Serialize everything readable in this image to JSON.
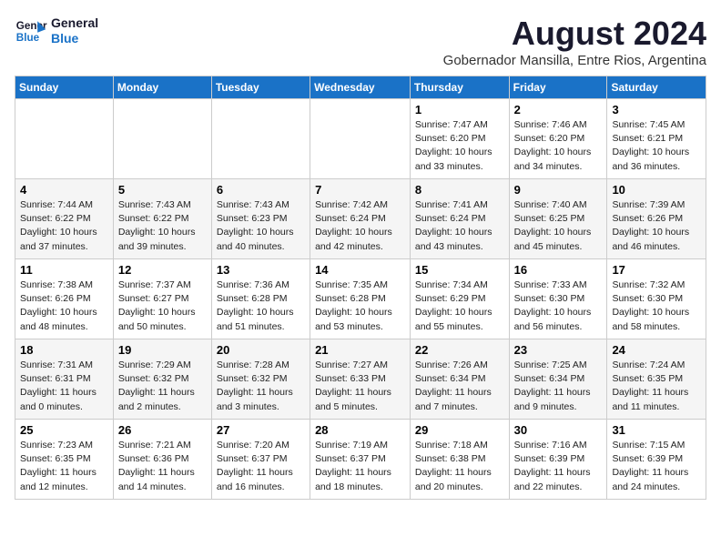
{
  "logo": {
    "line1": "General",
    "line2": "Blue"
  },
  "title": "August 2024",
  "subtitle": "Gobernador Mansilla, Entre Rios, Argentina",
  "days_of_week": [
    "Sunday",
    "Monday",
    "Tuesday",
    "Wednesday",
    "Thursday",
    "Friday",
    "Saturday"
  ],
  "weeks": [
    [
      {
        "day": "",
        "info": ""
      },
      {
        "day": "",
        "info": ""
      },
      {
        "day": "",
        "info": ""
      },
      {
        "day": "",
        "info": ""
      },
      {
        "day": "1",
        "info": "Sunrise: 7:47 AM\nSunset: 6:20 PM\nDaylight: 10 hours\nand 33 minutes."
      },
      {
        "day": "2",
        "info": "Sunrise: 7:46 AM\nSunset: 6:20 PM\nDaylight: 10 hours\nand 34 minutes."
      },
      {
        "day": "3",
        "info": "Sunrise: 7:45 AM\nSunset: 6:21 PM\nDaylight: 10 hours\nand 36 minutes."
      }
    ],
    [
      {
        "day": "4",
        "info": "Sunrise: 7:44 AM\nSunset: 6:22 PM\nDaylight: 10 hours\nand 37 minutes."
      },
      {
        "day": "5",
        "info": "Sunrise: 7:43 AM\nSunset: 6:22 PM\nDaylight: 10 hours\nand 39 minutes."
      },
      {
        "day": "6",
        "info": "Sunrise: 7:43 AM\nSunset: 6:23 PM\nDaylight: 10 hours\nand 40 minutes."
      },
      {
        "day": "7",
        "info": "Sunrise: 7:42 AM\nSunset: 6:24 PM\nDaylight: 10 hours\nand 42 minutes."
      },
      {
        "day": "8",
        "info": "Sunrise: 7:41 AM\nSunset: 6:24 PM\nDaylight: 10 hours\nand 43 minutes."
      },
      {
        "day": "9",
        "info": "Sunrise: 7:40 AM\nSunset: 6:25 PM\nDaylight: 10 hours\nand 45 minutes."
      },
      {
        "day": "10",
        "info": "Sunrise: 7:39 AM\nSunset: 6:26 PM\nDaylight: 10 hours\nand 46 minutes."
      }
    ],
    [
      {
        "day": "11",
        "info": "Sunrise: 7:38 AM\nSunset: 6:26 PM\nDaylight: 10 hours\nand 48 minutes."
      },
      {
        "day": "12",
        "info": "Sunrise: 7:37 AM\nSunset: 6:27 PM\nDaylight: 10 hours\nand 50 minutes."
      },
      {
        "day": "13",
        "info": "Sunrise: 7:36 AM\nSunset: 6:28 PM\nDaylight: 10 hours\nand 51 minutes."
      },
      {
        "day": "14",
        "info": "Sunrise: 7:35 AM\nSunset: 6:28 PM\nDaylight: 10 hours\nand 53 minutes."
      },
      {
        "day": "15",
        "info": "Sunrise: 7:34 AM\nSunset: 6:29 PM\nDaylight: 10 hours\nand 55 minutes."
      },
      {
        "day": "16",
        "info": "Sunrise: 7:33 AM\nSunset: 6:30 PM\nDaylight: 10 hours\nand 56 minutes."
      },
      {
        "day": "17",
        "info": "Sunrise: 7:32 AM\nSunset: 6:30 PM\nDaylight: 10 hours\nand 58 minutes."
      }
    ],
    [
      {
        "day": "18",
        "info": "Sunrise: 7:31 AM\nSunset: 6:31 PM\nDaylight: 11 hours\nand 0 minutes."
      },
      {
        "day": "19",
        "info": "Sunrise: 7:29 AM\nSunset: 6:32 PM\nDaylight: 11 hours\nand 2 minutes."
      },
      {
        "day": "20",
        "info": "Sunrise: 7:28 AM\nSunset: 6:32 PM\nDaylight: 11 hours\nand 3 minutes."
      },
      {
        "day": "21",
        "info": "Sunrise: 7:27 AM\nSunset: 6:33 PM\nDaylight: 11 hours\nand 5 minutes."
      },
      {
        "day": "22",
        "info": "Sunrise: 7:26 AM\nSunset: 6:34 PM\nDaylight: 11 hours\nand 7 minutes."
      },
      {
        "day": "23",
        "info": "Sunrise: 7:25 AM\nSunset: 6:34 PM\nDaylight: 11 hours\nand 9 minutes."
      },
      {
        "day": "24",
        "info": "Sunrise: 7:24 AM\nSunset: 6:35 PM\nDaylight: 11 hours\nand 11 minutes."
      }
    ],
    [
      {
        "day": "25",
        "info": "Sunrise: 7:23 AM\nSunset: 6:35 PM\nDaylight: 11 hours\nand 12 minutes."
      },
      {
        "day": "26",
        "info": "Sunrise: 7:21 AM\nSunset: 6:36 PM\nDaylight: 11 hours\nand 14 minutes."
      },
      {
        "day": "27",
        "info": "Sunrise: 7:20 AM\nSunset: 6:37 PM\nDaylight: 11 hours\nand 16 minutes."
      },
      {
        "day": "28",
        "info": "Sunrise: 7:19 AM\nSunset: 6:37 PM\nDaylight: 11 hours\nand 18 minutes."
      },
      {
        "day": "29",
        "info": "Sunrise: 7:18 AM\nSunset: 6:38 PM\nDaylight: 11 hours\nand 20 minutes."
      },
      {
        "day": "30",
        "info": "Sunrise: 7:16 AM\nSunset: 6:39 PM\nDaylight: 11 hours\nand 22 minutes."
      },
      {
        "day": "31",
        "info": "Sunrise: 7:15 AM\nSunset: 6:39 PM\nDaylight: 11 hours\nand 24 minutes."
      }
    ]
  ]
}
